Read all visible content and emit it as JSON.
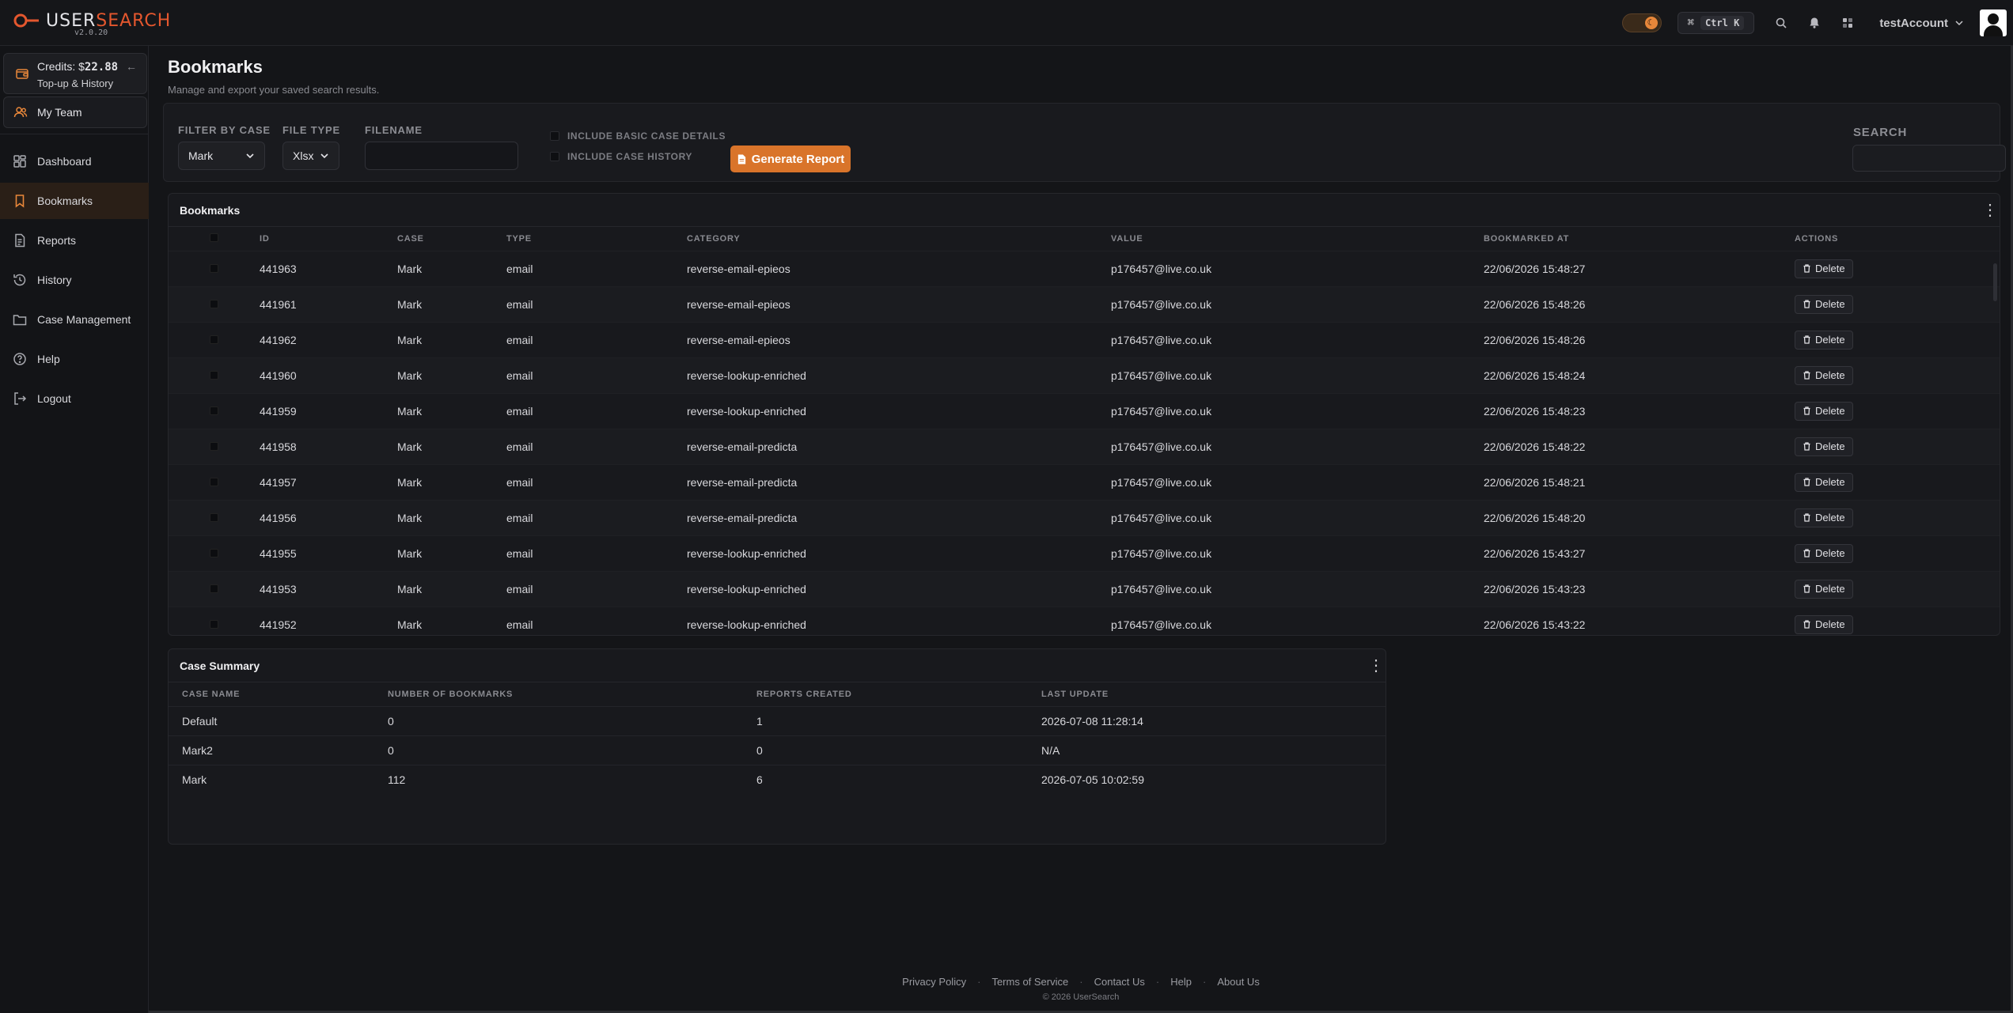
{
  "app": {
    "logo_left": "USER",
    "logo_right": "SEARCH",
    "version": "v2.0.20",
    "shortcut_cmd": "⌘",
    "shortcut_keys": "Ctrl K",
    "account": "testAccount",
    "accent_color": "#d9742a"
  },
  "sidebar": {
    "credits_prefix": "Credits: $",
    "credits_value": "22.88",
    "topup_label": "Top-up & History",
    "team_label": "My Team",
    "nav": [
      {
        "label": "Dashboard",
        "icon": "dashboard-icon"
      },
      {
        "label": "Bookmarks",
        "icon": "bookmark-icon",
        "active": true
      },
      {
        "label": "Reports",
        "icon": "report-icon"
      },
      {
        "label": "History",
        "icon": "history-icon"
      },
      {
        "label": "Case Management",
        "icon": "folder-icon"
      },
      {
        "label": "Help",
        "icon": "help-icon"
      },
      {
        "label": "Logout",
        "icon": "logout-icon"
      }
    ]
  },
  "page": {
    "title": "Bookmarks",
    "subtitle": "Manage and export your saved search results."
  },
  "filters": {
    "case_label": "FILTER BY CASE",
    "case_value": "Mark",
    "type_label": "FILE TYPE",
    "type_value": "Xlsx",
    "filename_label": "FILENAME",
    "filename_value": "",
    "include_basic": "INCLUDE BASIC CASE DETAILS",
    "include_history": "INCLUDE CASE HISTORY",
    "generate_label": "Generate Report",
    "search_label": "SEARCH",
    "search_value": ""
  },
  "bookmarks": {
    "title": "Bookmarks",
    "columns": [
      "ID",
      "CASE",
      "TYPE",
      "CATEGORY",
      "VALUE",
      "BOOKMARKED AT",
      "ACTIONS"
    ],
    "delete_label": "Delete",
    "rows": [
      {
        "id": "441963",
        "case": "Mark",
        "type": "email",
        "category": "reverse-email-epieos",
        "value": "p176457@live.co.uk",
        "at": "22/06/2026 15:48:27"
      },
      {
        "id": "441961",
        "case": "Mark",
        "type": "email",
        "category": "reverse-email-epieos",
        "value": "p176457@live.co.uk",
        "at": "22/06/2026 15:48:26"
      },
      {
        "id": "441962",
        "case": "Mark",
        "type": "email",
        "category": "reverse-email-epieos",
        "value": "p176457@live.co.uk",
        "at": "22/06/2026 15:48:26"
      },
      {
        "id": "441960",
        "case": "Mark",
        "type": "email",
        "category": "reverse-lookup-enriched",
        "value": "p176457@live.co.uk",
        "at": "22/06/2026 15:48:24"
      },
      {
        "id": "441959",
        "case": "Mark",
        "type": "email",
        "category": "reverse-lookup-enriched",
        "value": "p176457@live.co.uk",
        "at": "22/06/2026 15:48:23"
      },
      {
        "id": "441958",
        "case": "Mark",
        "type": "email",
        "category": "reverse-email-predicta",
        "value": "p176457@live.co.uk",
        "at": "22/06/2026 15:48:22"
      },
      {
        "id": "441957",
        "case": "Mark",
        "type": "email",
        "category": "reverse-email-predicta",
        "value": "p176457@live.co.uk",
        "at": "22/06/2026 15:48:21"
      },
      {
        "id": "441956",
        "case": "Mark",
        "type": "email",
        "category": "reverse-email-predicta",
        "value": "p176457@live.co.uk",
        "at": "22/06/2026 15:48:20"
      },
      {
        "id": "441955",
        "case": "Mark",
        "type": "email",
        "category": "reverse-lookup-enriched",
        "value": "p176457@live.co.uk",
        "at": "22/06/2026 15:43:27"
      },
      {
        "id": "441953",
        "case": "Mark",
        "type": "email",
        "category": "reverse-lookup-enriched",
        "value": "p176457@live.co.uk",
        "at": "22/06/2026 15:43:23"
      },
      {
        "id": "441952",
        "case": "Mark",
        "type": "email",
        "category": "reverse-lookup-enriched",
        "value": "p176457@live.co.uk",
        "at": "22/06/2026 15:43:22"
      }
    ]
  },
  "case_summary": {
    "title": "Case Summary",
    "columns": [
      "CASE NAME",
      "NUMBER OF BOOKMARKS",
      "REPORTS CREATED",
      "LAST UPDATE"
    ],
    "rows": [
      {
        "name": "Default",
        "bookmarks": "0",
        "reports": "1",
        "updated": "2026-07-08 11:28:14"
      },
      {
        "name": "Mark2",
        "bookmarks": "0",
        "reports": "0",
        "updated": "N/A"
      },
      {
        "name": "Mark",
        "bookmarks": "112",
        "reports": "6",
        "updated": "2026-07-05 10:02:59"
      }
    ]
  },
  "footer": {
    "links": [
      "Privacy Policy",
      "Terms of Service",
      "Contact Us",
      "Help",
      "About Us"
    ],
    "copyright": "© 2026 UserSearch"
  }
}
